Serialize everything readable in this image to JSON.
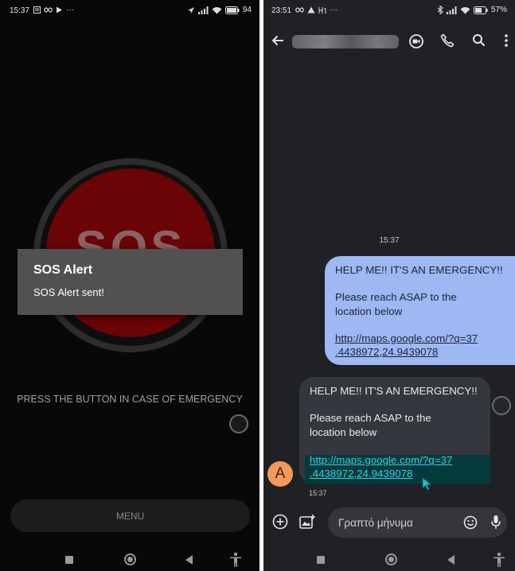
{
  "left_phone": {
    "status_time": "15:37",
    "battery": "94",
    "sos_button_label": "SOS",
    "alert_dialog": {
      "title": "SOS Alert",
      "message": "SOS Alert sent!"
    },
    "instruction": "PRESS THE BUTTON IN CASE OF EMERGENCY",
    "menu_label": "MENU"
  },
  "right_phone": {
    "status_time": "23:51",
    "battery": "57%",
    "timestamp": "15:37",
    "sent_message": {
      "line1": "HELP ME!! IT'S AN EMERGENCY!!",
      "line2": "Please reach ASAP to the",
      "line3": "location below",
      "link_line1": "http://maps.google.com/?q=37",
      "link_line2": ".4438972,24.9439078"
    },
    "received_message": {
      "line1": "HELP ME!! IT'S AN EMERGENCY!!",
      "line2": "Please reach ASAP to the",
      "line3": "location below",
      "link_line1": "http://maps.google.com/?q=37",
      "link_line2": ".4438972,24.9439078",
      "time": "15:37"
    },
    "avatar_letter": "A",
    "compose_placeholder": "Γραπτό μήνυμα"
  },
  "colors": {
    "sos_red": "#6a0406",
    "sent_bubble": "#9db8f3",
    "received_bubble": "#34373d",
    "link_cyan": "#34d2e0",
    "avatar_orange": "#f39a5a"
  },
  "icons": [
    "back-arrow-icon",
    "video-call-icon",
    "phone-icon",
    "search-icon",
    "more-vert-icon",
    "add-icon",
    "gallery-icon",
    "emoji-icon",
    "mic-icon",
    "accessibility-icon",
    "cursor-icon"
  ]
}
